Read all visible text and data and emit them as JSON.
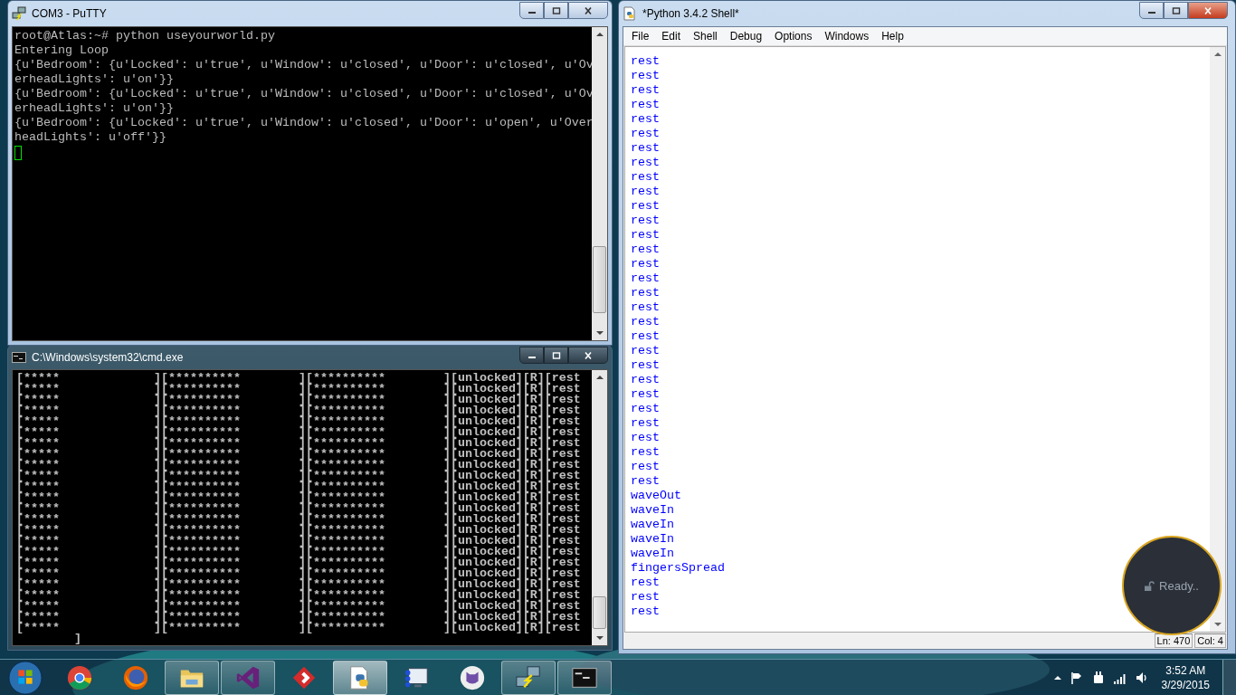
{
  "putty": {
    "title": "COM3 - PuTTY",
    "lines": [
      "root@Atlas:~# python useyourworld.py",
      "Entering Loop",
      "{u'Bedroom': {u'Locked': u'true', u'Window': u'closed', u'Door': u'closed', u'Ov",
      "erheadLights': u'on'}}",
      "{u'Bedroom': {u'Locked': u'true', u'Window': u'closed', u'Door': u'closed', u'Ov",
      "erheadLights': u'on'}}",
      "{u'Bedroom': {u'Locked': u'true', u'Window': u'closed', u'Door': u'open', u'Over",
      "headLights': u'off'}}"
    ]
  },
  "cmd": {
    "title": "C:\\Windows\\system32\\cmd.exe",
    "lines": [
      "[*****             ][**********        ][**********        ][unlocked][R][rest",
      "[*****             ][**********        ][**********        ][unlocked][R][rest",
      "[*****             ][**********        ][**********        ][unlocked][R][rest",
      "[*****             ][**********        ][**********        ][unlocked][R][rest",
      "[*****             ][**********        ][**********        ][unlocked][R][rest",
      "[*****             ][**********        ][**********        ][unlocked][R][rest",
      "[*****             ][**********        ][**********        ][unlocked][R][rest",
      "[*****             ][**********        ][**********        ][unlocked][R][rest",
      "[*****             ][**********        ][**********        ][unlocked][R][rest",
      "[*****             ][**********        ][**********        ][unlocked][R][rest",
      "[*****             ][**********        ][**********        ][unlocked][R][rest",
      "[*****             ][**********        ][**********        ][unlocked][R][rest",
      "[*****             ][**********        ][**********        ][unlocked][R][rest",
      "[*****             ][**********        ][**********        ][unlocked][R][rest",
      "[*****             ][**********        ][**********        ][unlocked][R][rest",
      "[*****             ][**********        ][**********        ][unlocked][R][rest",
      "[*****             ][**********        ][**********        ][unlocked][R][rest",
      "[*****             ][**********        ][**********        ][unlocked][R][rest",
      "[*****             ][**********        ][**********        ][unlocked][R][rest",
      "[*****             ][**********        ][**********        ][unlocked][R][rest",
      "[*****             ][**********        ][**********        ][unlocked][R][rest",
      "[*****             ][**********        ][**********        ][unlocked][R][rest",
      "[*****             ][**********        ][**********        ][unlocked][R][rest",
      "[*****             ][**********        ][**********        ][unlocked][R][rest",
      "        ]"
    ]
  },
  "idle": {
    "title": "*Python 3.4.2 Shell*",
    "menu": [
      "File",
      "Edit",
      "Shell",
      "Debug",
      "Options",
      "Windows",
      "Help"
    ],
    "lines": [
      "rest",
      "rest",
      "rest",
      "rest",
      "rest",
      "rest",
      "rest",
      "rest",
      "rest",
      "rest",
      "rest",
      "rest",
      "rest",
      "rest",
      "rest",
      "rest",
      "rest",
      "rest",
      "rest",
      "rest",
      "rest",
      "rest",
      "rest",
      "rest",
      "rest",
      "rest",
      "rest",
      "rest",
      "rest",
      "rest",
      "waveOut",
      "waveIn",
      "waveIn",
      "waveIn",
      "waveIn",
      "fingersSpread",
      "rest",
      "rest",
      "rest"
    ],
    "status": [
      "Ln: 470",
      "Col: 4"
    ]
  },
  "overlay": {
    "text": "Ready.."
  },
  "taskbar": {
    "apps": [
      {
        "kind": "chrome",
        "open": false,
        "selected": false
      },
      {
        "kind": "firefox",
        "open": false,
        "selected": false
      },
      {
        "kind": "folder",
        "open": true,
        "selected": false
      },
      {
        "kind": "studio",
        "open": true,
        "selected": false
      },
      {
        "kind": "diamond",
        "open": false,
        "selected": false
      },
      {
        "kind": "python",
        "open": true,
        "selected": true
      },
      {
        "kind": "monitor",
        "open": false,
        "selected": false
      },
      {
        "kind": "cat",
        "open": false,
        "selected": false
      },
      {
        "kind": "putty",
        "open": true,
        "selected": false
      },
      {
        "kind": "console",
        "open": true,
        "selected": false
      }
    ],
    "time": "3:52 AM",
    "date": "3/29/2015"
  }
}
